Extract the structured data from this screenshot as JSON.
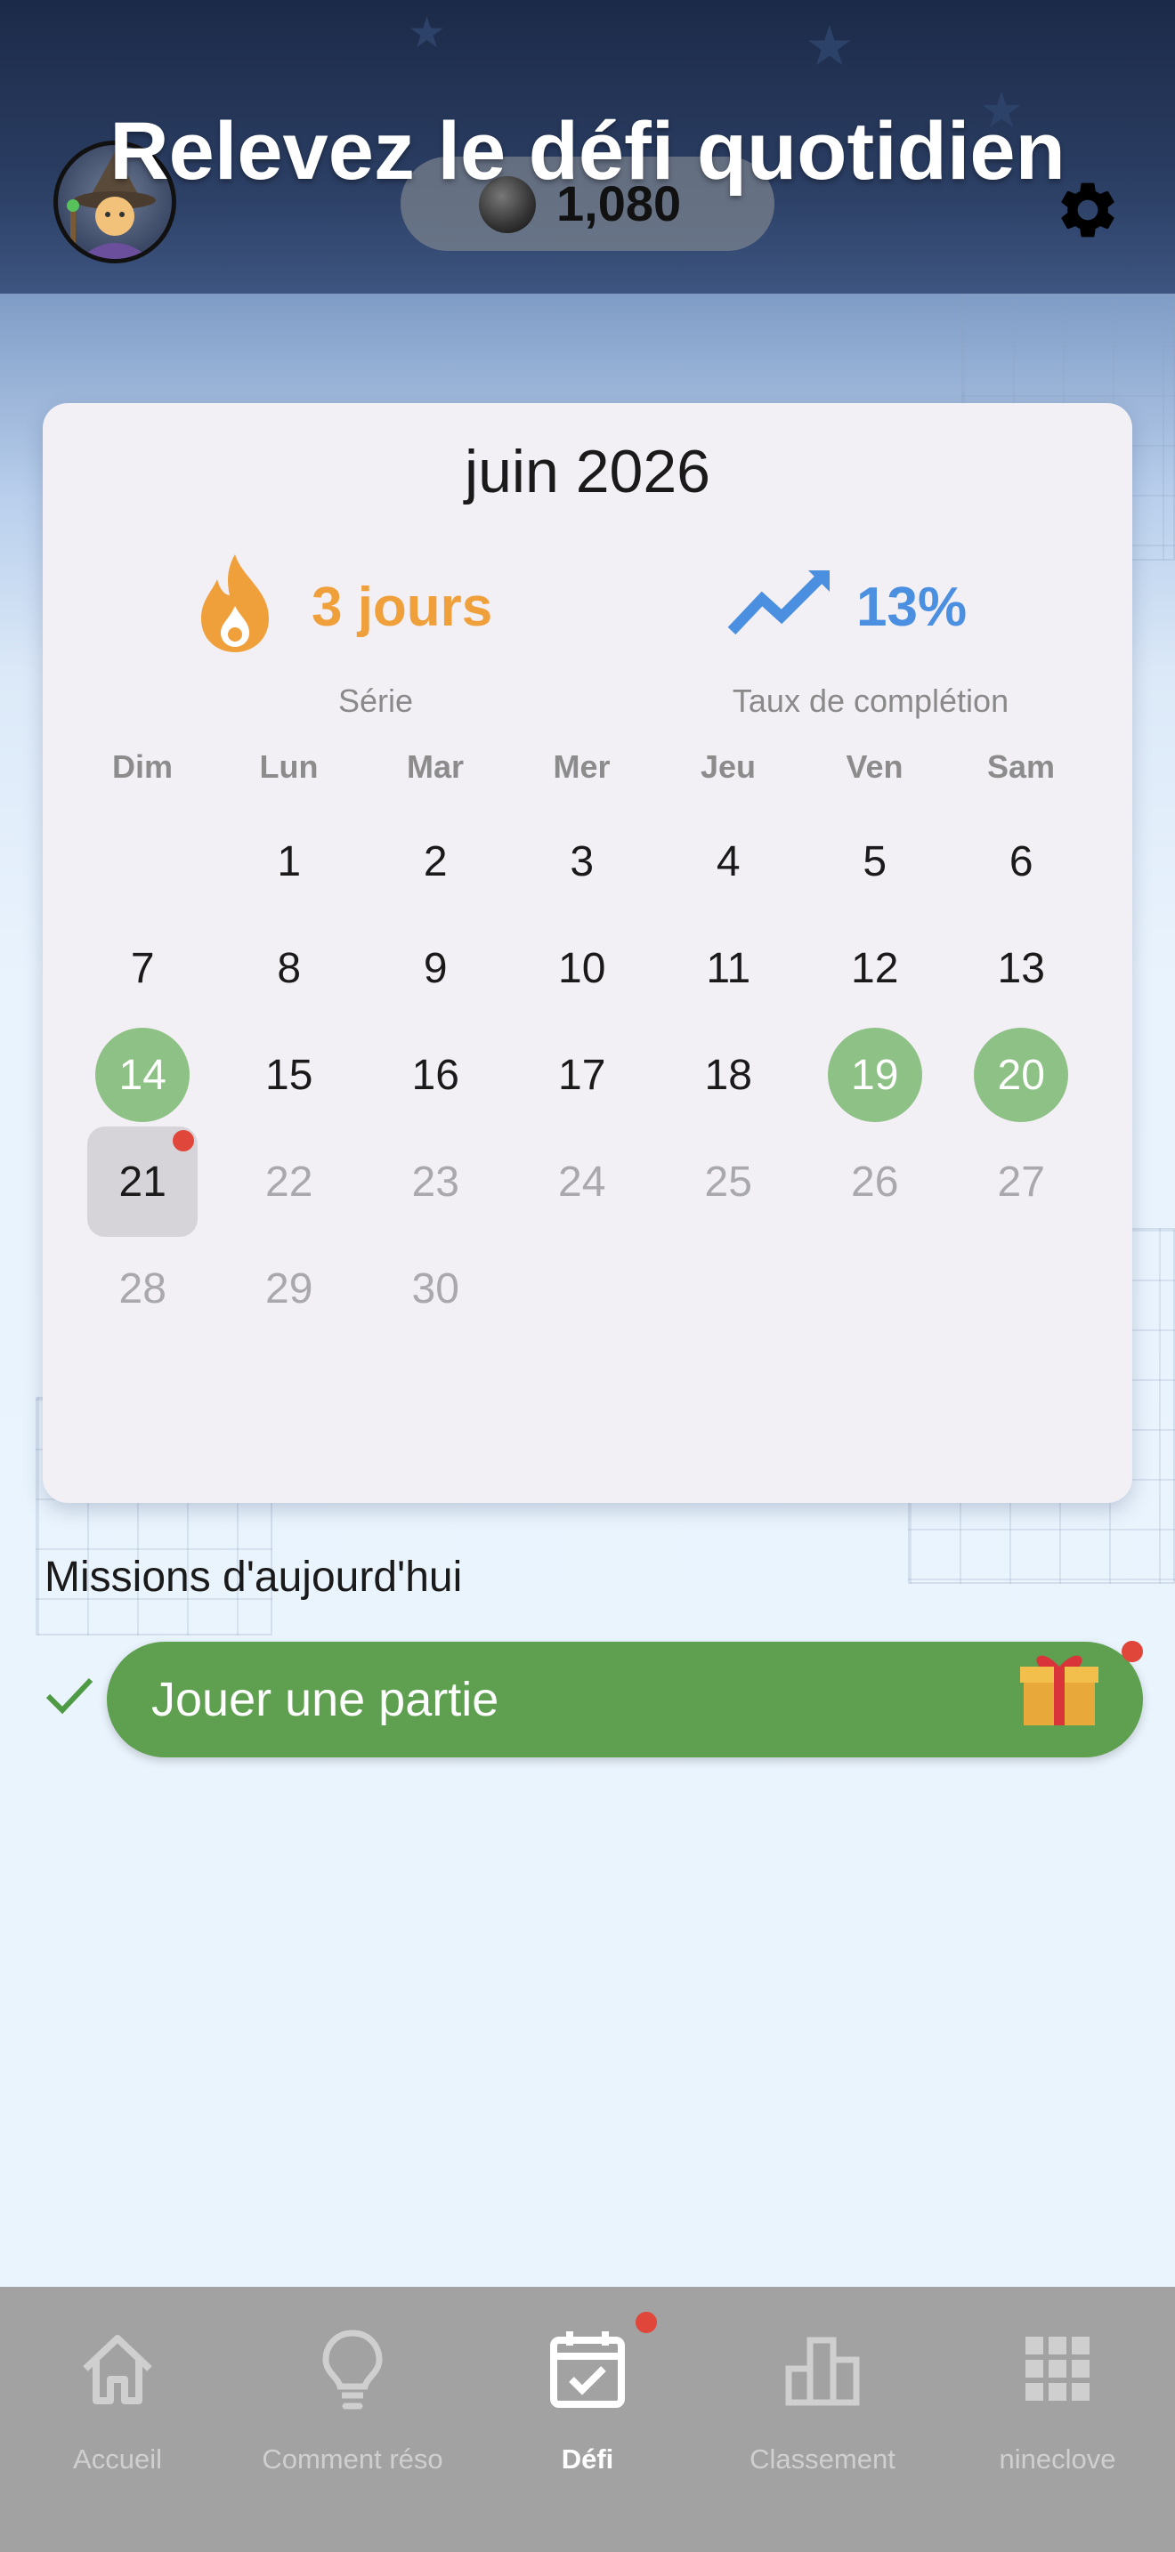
{
  "header": {
    "title": "Relevez le défi quotidien",
    "coins": "1,080",
    "avatar_icon": "wizard-avatar",
    "settings_icon": "gear-icon"
  },
  "calendar": {
    "month": "juin 2026",
    "streak": {
      "value": "3 jours",
      "label": "Série",
      "color": "#f0a03a",
      "icon": "flame-icon"
    },
    "completion": {
      "value": "13%",
      "label": "Taux de complétion",
      "color": "#4a8fe0",
      "icon": "trend-up-icon"
    },
    "weekdays": [
      "Dim",
      "Lun",
      "Mar",
      "Mer",
      "Jeu",
      "Ven",
      "Sam"
    ],
    "first_weekday_offset": 1,
    "days_in_month": 30,
    "today": 21,
    "completed_days": [
      14,
      19,
      20
    ],
    "colors": {
      "done": "#8ec185",
      "today_bg": "#d6d4d8",
      "future": "#a9a9ad",
      "badge": "#e0463a"
    }
  },
  "missions": {
    "title": "Missions d'aujourd'hui",
    "items": [
      {
        "label": "Jouer une partie",
        "completed": true,
        "reward_icon": "gift-icon"
      }
    ],
    "accent": "#5ea04f"
  },
  "tabbar": {
    "items": [
      {
        "label": "Accueil",
        "icon": "home-icon"
      },
      {
        "label": "Comment réso",
        "icon": "lightbulb-icon"
      },
      {
        "label": "Défi",
        "icon": "calendar-check-icon"
      },
      {
        "label": "Classement",
        "icon": "bar-chart-icon"
      },
      {
        "label": "nineclove",
        "icon": "grid-icon"
      }
    ],
    "active_index": 2
  }
}
